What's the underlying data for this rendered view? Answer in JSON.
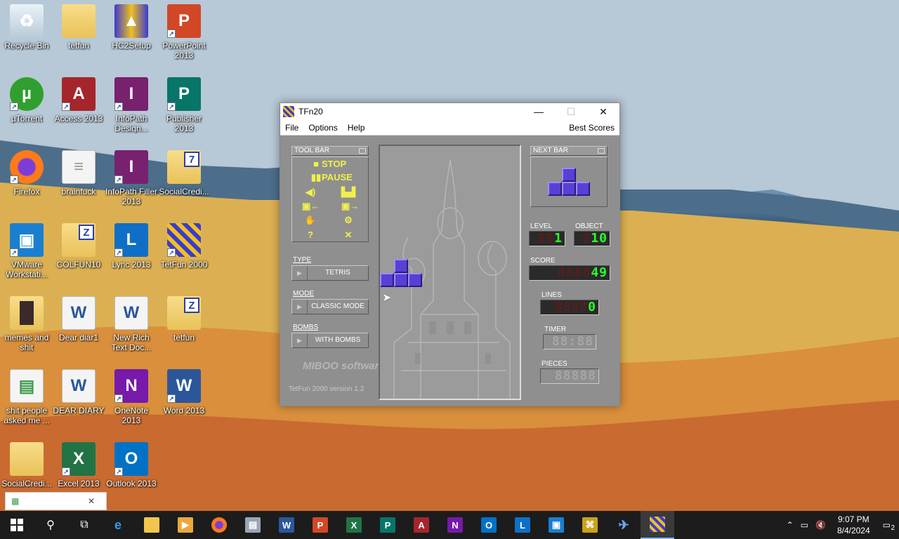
{
  "desktop": {
    "icons": [
      {
        "label": "Recycle Bin"
      },
      {
        "label": "tetfun"
      },
      {
        "label": "HC2Setup"
      },
      {
        "label": "PowerPoint 2013"
      },
      {
        "label": "µTorrent"
      },
      {
        "label": "Access 2013"
      },
      {
        "label": "InfoPath Design..."
      },
      {
        "label": "Publisher 2013"
      },
      {
        "label": "Firefox"
      },
      {
        "label": "brainfuck"
      },
      {
        "label": "InfoPath Filler 2013"
      },
      {
        "label": "SocialCredi..."
      },
      {
        "label": "VMware Workstati..."
      },
      {
        "label": "COLFUN10"
      },
      {
        "label": "Lync 2013"
      },
      {
        "label": "TetFun 2000"
      },
      {
        "label": "memes and shit"
      },
      {
        "label": "Dear diar1"
      },
      {
        "label": "New Rich Text Doc..."
      },
      {
        "label": "tetfun"
      },
      {
        "label": "shit people asked me ..."
      },
      {
        "label": "DEAR DIARY"
      },
      {
        "label": "OneNote 2013"
      },
      {
        "label": "Word 2013"
      },
      {
        "label": "SocialCredi..."
      },
      {
        "label": "Excel 2013"
      },
      {
        "label": "Outlook 2013"
      }
    ]
  },
  "window": {
    "title": "TFn20",
    "menu": {
      "file": "File",
      "options": "Options",
      "help": "Help",
      "best_scores": "Best Scores"
    },
    "toolbar": {
      "title": "TOOL BAR",
      "stop": "STOP",
      "pause": "PAUSE",
      "help_glyph": "?",
      "close_glyph": "✕"
    },
    "nextbar": {
      "title": "NEXT BAR"
    },
    "type": {
      "label": "TYPE",
      "value": "TETRIS"
    },
    "mode": {
      "label": "MODE",
      "value": "CLASSIC MODE"
    },
    "bombs": {
      "label": "BOMBS",
      "value": "WITH BOMBS"
    },
    "logo": "MIBOO software",
    "footer": "TetFun 2000 version 1.2",
    "stats": {
      "level_label": "LEVEL",
      "level_off": "88",
      "level_on": "1",
      "object_label": "OBJECT",
      "object_off": "8",
      "object_on": "10",
      "score_label": "SCORE",
      "score_off": "8888",
      "score_on": "49",
      "lines_label": "LINES",
      "lines_off": "8888",
      "lines_on": "0",
      "timer_label": "TIMER",
      "timer_value": "88:88",
      "pieces_label": "PIECES",
      "pieces_value": "88888"
    }
  },
  "taskbar": {
    "time": "9:07 PM",
    "date": "8/4/2024",
    "notifications": "2"
  },
  "colors": {
    "led_on": "#2aff2a",
    "tool_yellow": "#f2f04a",
    "block": "#5a3fd6"
  }
}
